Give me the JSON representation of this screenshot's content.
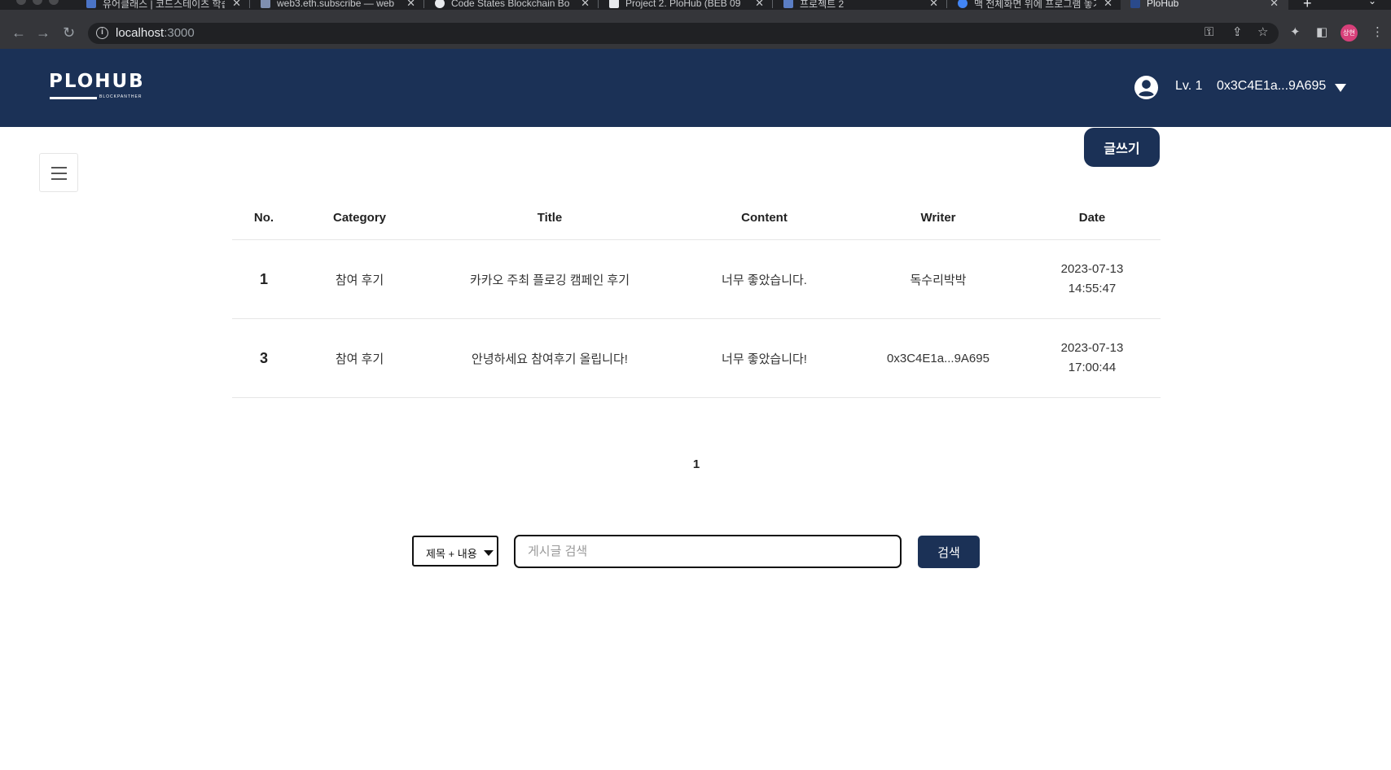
{
  "browser": {
    "tabs": [
      {
        "title": "유어클래스 | 코드스테이츠 학습",
        "color": "#4b74c6"
      },
      {
        "title": "web3.eth.subscribe — web",
        "color": "#7f8fb0"
      },
      {
        "title": "Code States Blockchain Bo",
        "color": "#e8eaed"
      },
      {
        "title": "Project 2. PloHub (BEB 09",
        "color": "#e8eaed"
      },
      {
        "title": "프로젝트 2",
        "color": "#5b7ec4"
      },
      {
        "title": "맥 전체화면 위에 프로그램 놓기",
        "color": "#4285f4"
      },
      {
        "title": "PloHub",
        "color": "#2a4a8a"
      }
    ],
    "close_glyph": "✕",
    "new_tab_glyph": "+",
    "url_host": "localhost",
    "url_port": ":3000",
    "profile_initials": "상현"
  },
  "header": {
    "logo": "PLOHUB",
    "logo_sub": "BLOCKPANTHER",
    "user_level": "Lv. 1",
    "user_address": "0x3C4E1a...9A695"
  },
  "actions": {
    "write_label": "글쓰기"
  },
  "board": {
    "columns": [
      "No.",
      "Category",
      "Title",
      "Content",
      "Writer",
      "Date"
    ],
    "rows": [
      {
        "no": "1",
        "category": "참여 후기",
        "title": "카카오 주최 플로깅 캠페인 후기",
        "content": "너무 좋았습니다.",
        "writer": "독수리박박",
        "date": "2023-07-13",
        "time": "14:55:47"
      },
      {
        "no": "3",
        "category": "참여 후기",
        "title": "안녕하세요 참여후기 올립니다!",
        "content": "너무 좋았습니다!",
        "writer": "0x3C4E1a...9A695",
        "date": "2023-07-13",
        "time": "17:00:44"
      }
    ]
  },
  "pagination": {
    "current": "1"
  },
  "search": {
    "filter_selected": "제목 + 내용",
    "placeholder": "게시글 검색",
    "button_label": "검색"
  },
  "colors": {
    "brand_navy": "#1b3156"
  }
}
